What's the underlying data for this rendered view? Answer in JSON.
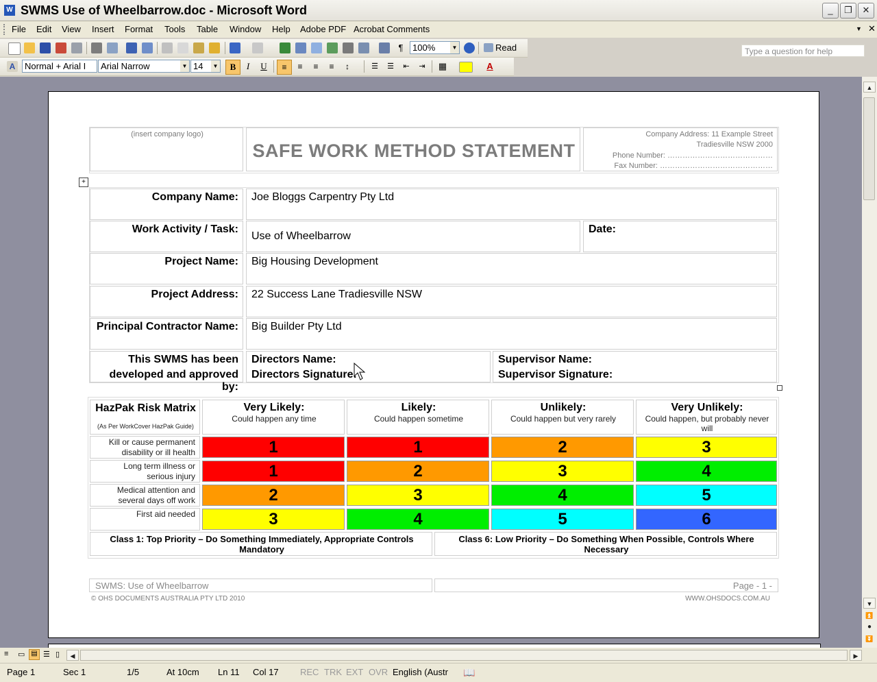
{
  "window": {
    "title": "SWMS Use of Wheelbarrow.doc - Microsoft Word",
    "icon": "word-doc-icon"
  },
  "menu": {
    "items": [
      "File",
      "Edit",
      "View",
      "Insert",
      "Format",
      "Tools",
      "Table",
      "Window",
      "Help",
      "Adobe PDF",
      "Acrobat Comments"
    ],
    "help_placeholder": "Type a question for help"
  },
  "standard_toolbar": {
    "zoom": "100%",
    "read_label": "Read"
  },
  "formatting_toolbar": {
    "style": "Normal + Arial I",
    "font": "Arial Narrow",
    "size": "14",
    "bold": "B",
    "italic": "I",
    "underline": "U"
  },
  "document": {
    "header": {
      "logo_placeholder": "(insert company logo)",
      "heading": "SAFE WORK METHOD STATEMENT",
      "company_address": "Company Address:  11 Example Street",
      "address_line2": "Tradiesville NSW 2000",
      "phone": "Phone Number: ……………………………………",
      "fax": "Fax Number: ………………………………………"
    },
    "fields": {
      "company_label": "Company Name:",
      "company_value": "Joe Bloggs Carpentry Pty Ltd",
      "activity_label": "Work Activity / Task:",
      "activity_value": "Use of Wheelbarrow",
      "date_label": "Date:",
      "project_label": "Project Name:",
      "project_value": "Big Housing Development",
      "address_label": "Project Address:",
      "address_value": "22 Success Lane Tradiesville NSW",
      "principal_label": "Principal Contractor Name:",
      "principal_value": "Big Builder Pty Ltd",
      "approved_label_1": "This SWMS has been",
      "approved_label_2": "developed and approved by:",
      "directors_name": "Directors Name:",
      "directors_signature": "Directors Signature:",
      "supervisor_name": "Supervisor Name:",
      "supervisor_signature": "Supervisor Signature:"
    },
    "risk_matrix": {
      "title": "HazPak Risk Matrix",
      "subtitle": "(As Per WorkCover HazPak Guide)",
      "columns": [
        {
          "title": "Very Likely:",
          "desc": "Could happen any time"
        },
        {
          "title": "Likely:",
          "desc": "Could happen sometime"
        },
        {
          "title": "Unlikely:",
          "desc": "Could happen but very rarely"
        },
        {
          "title": "Very Unlikely:",
          "desc": "Could happen, but probably never will"
        }
      ],
      "rows": [
        {
          "label": "Kill or cause permanent disability or ill health",
          "values": [
            "1",
            "1",
            "2",
            "3"
          ]
        },
        {
          "label": "Long term illness or serious injury",
          "values": [
            "1",
            "2",
            "3",
            "4"
          ]
        },
        {
          "label": "Medical attention and several days off work",
          "values": [
            "2",
            "3",
            "4",
            "5"
          ]
        },
        {
          "label": "First aid needed",
          "values": [
            "3",
            "4",
            "5",
            "6"
          ]
        }
      ],
      "class_colors": {
        "1": "#ff0000",
        "2": "#ff9900",
        "3": "#ffff00",
        "4": "#00ee00",
        "5": "#00ffff",
        "6": "#3366ff"
      },
      "class1": "Class 1:  Top Priority – Do Something Immediately, Appropriate Controls Mandatory",
      "class6": "Class 6:  Low Priority – Do Something When Possible, Controls Where Necessary"
    },
    "footer": {
      "left": "SWMS: Use of Wheelbarrow",
      "right": "Page - 1 -",
      "copyright": "© OHS DOCUMENTS AUSTRALIA PTY LTD 2010",
      "website": "WWW.OHSDOCS.COM.AU"
    }
  },
  "status_bar": {
    "page": "Page  1",
    "sec": "Sec  1",
    "pages": "1/5",
    "at": "At  10cm",
    "ln": "Ln  11",
    "col": "Col  17",
    "rec": "REC",
    "trk": "TRK",
    "ext": "EXT",
    "ovr": "OVR",
    "language": "English (Austr"
  }
}
